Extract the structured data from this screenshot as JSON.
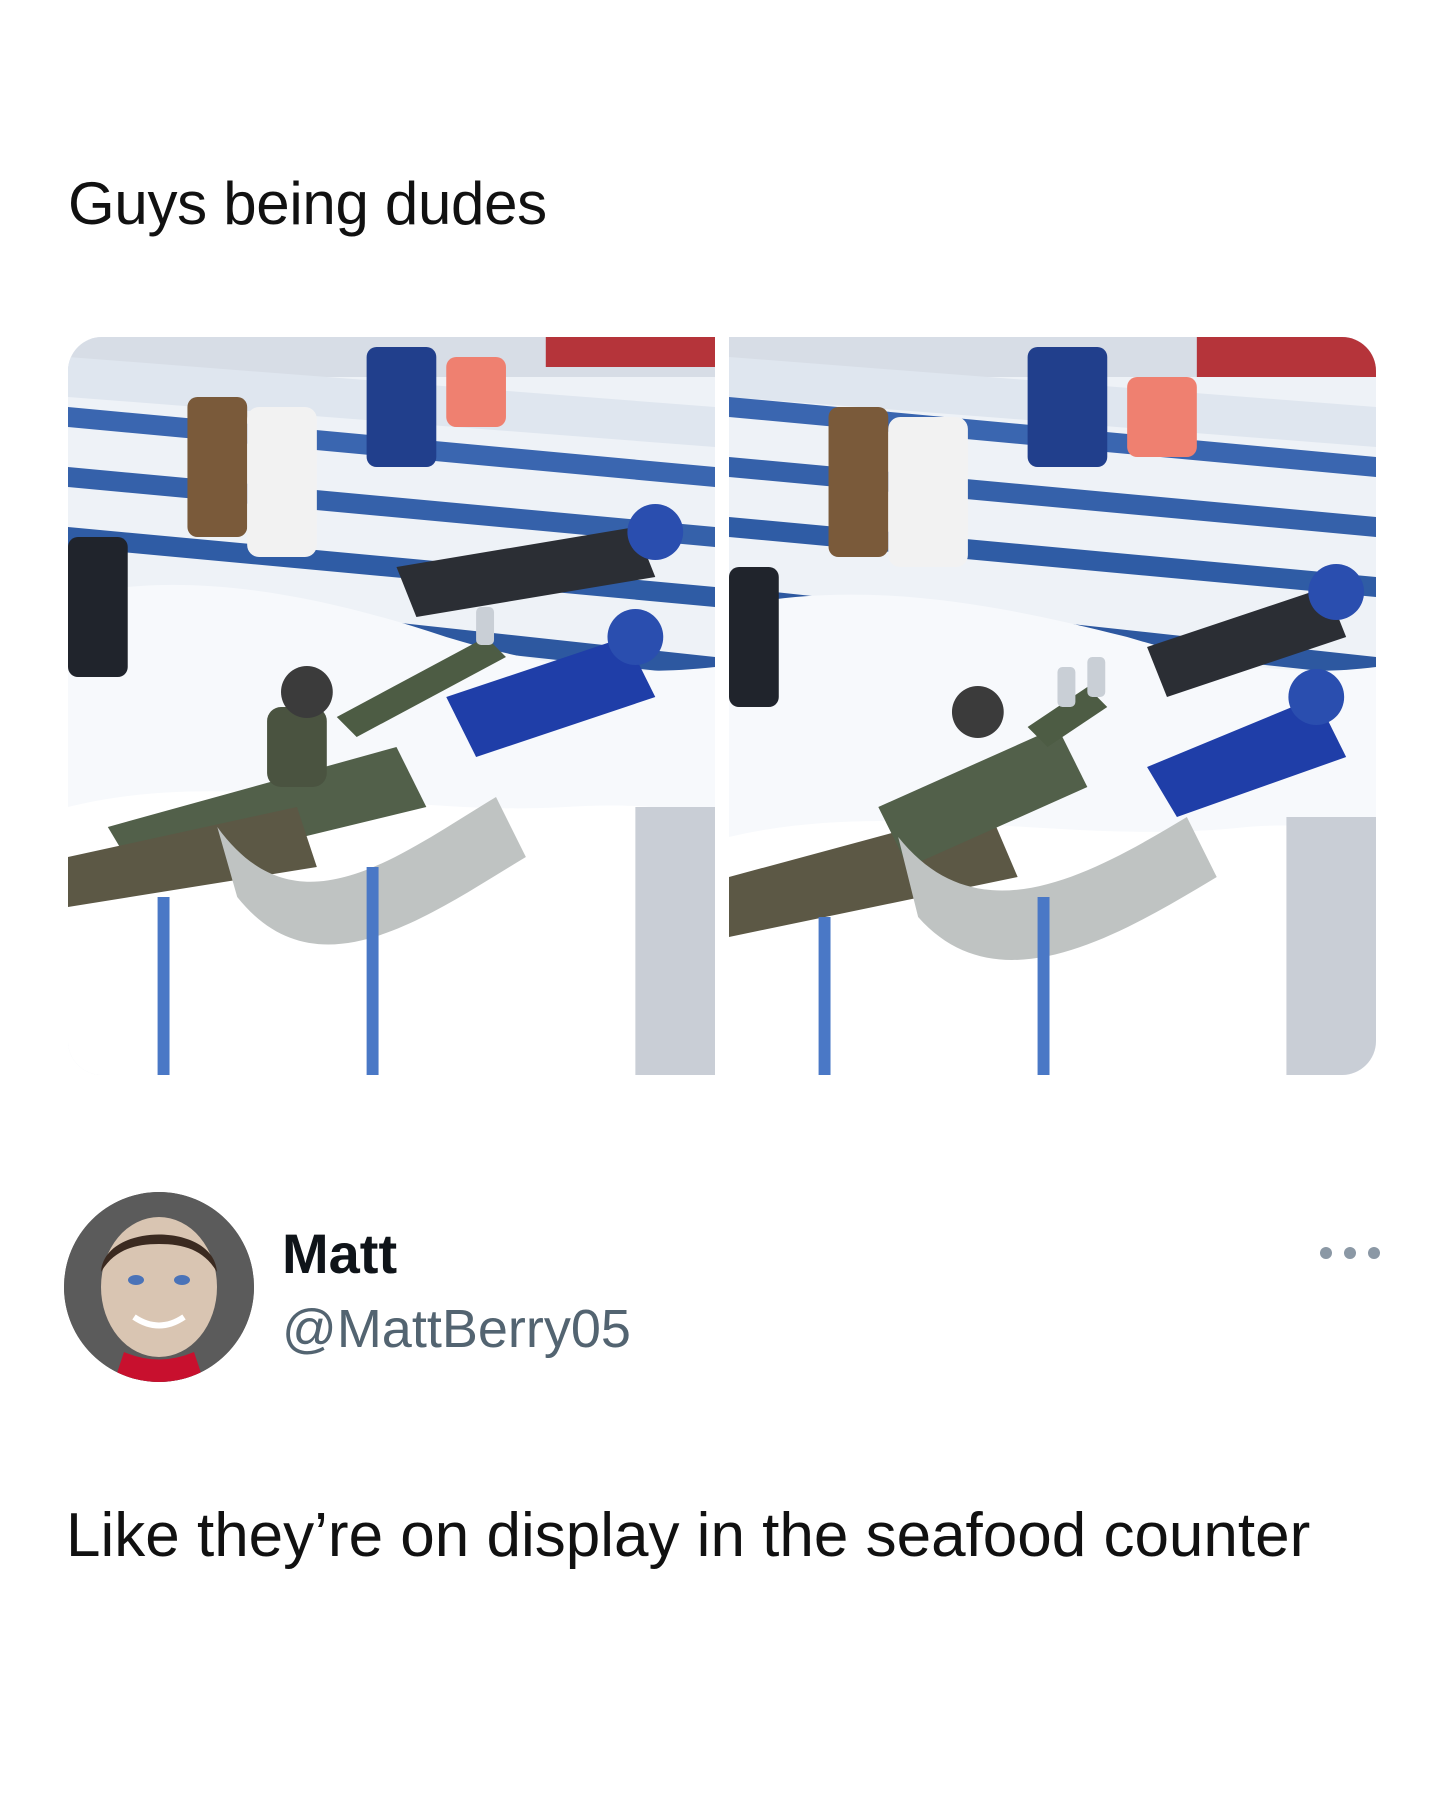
{
  "quoted_post": {
    "text": "Guys being dudes"
  },
  "media": {
    "photos": [
      {
        "icon": "snowy-stadium-fans-photo-1"
      },
      {
        "icon": "snowy-stadium-fans-photo-2"
      }
    ]
  },
  "author": {
    "name": "Matt",
    "handle": "@MattBerry05",
    "avatar_icon": "bobblehead-avatar",
    "more_icon": "more-options-icon"
  },
  "tweet": {
    "text": "Like they’re on display in the seafood counter"
  },
  "colors": {
    "text": "#111111",
    "secondary": "#536471",
    "snow": "#f3f6fa",
    "seat_blue": "#2f5fa8",
    "jersey_blue": "#1f3ea8",
    "accent_red": "#c8102e"
  }
}
